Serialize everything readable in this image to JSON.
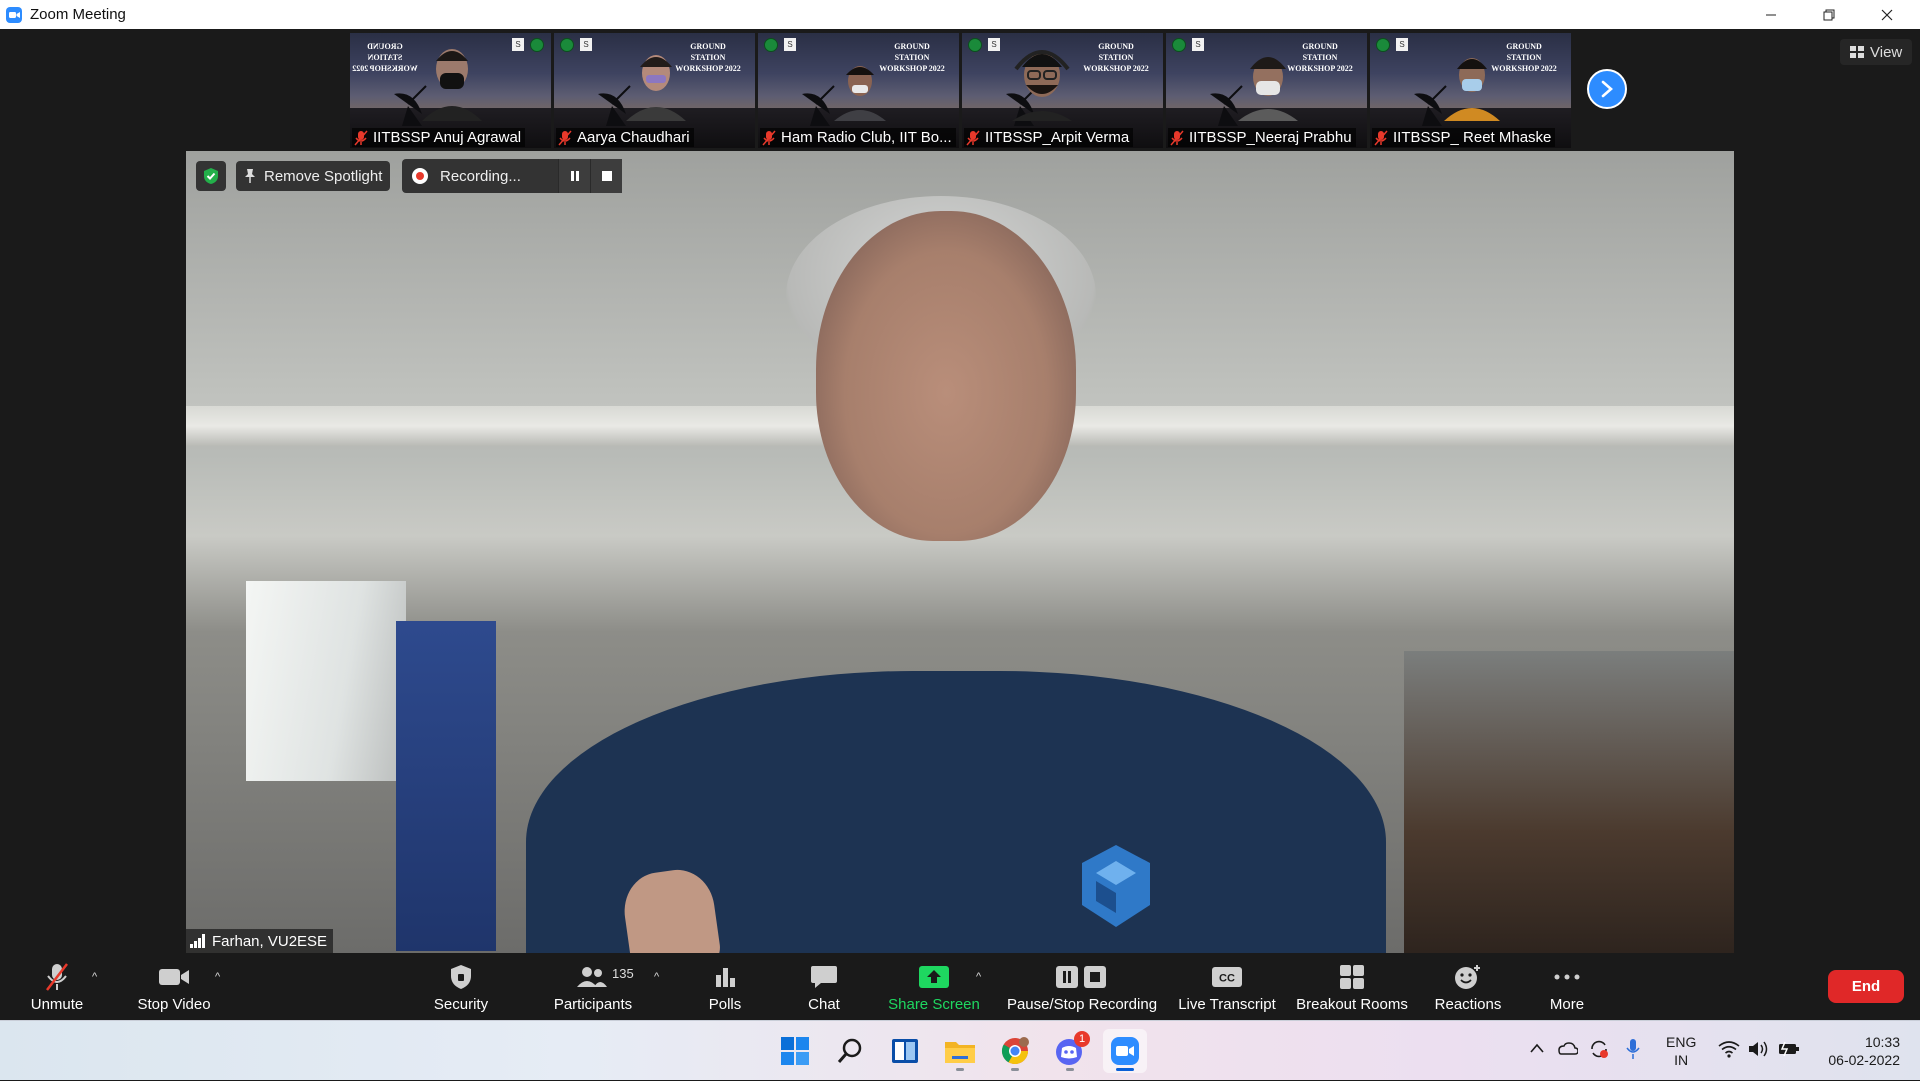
{
  "window": {
    "title": "Zoom Meeting"
  },
  "gallery": {
    "participants": [
      {
        "name": "IITBSSP Anuj Agrawal",
        "banner": "GROUND STATION WORKSHOP 2022",
        "muted": true
      },
      {
        "name": "Aarya Chaudhari",
        "banner": "GROUND STATION WORKSHOP 2022",
        "muted": true
      },
      {
        "name": "Ham Radio Club, IIT Bo...",
        "banner": "GROUND STATION WORKSHOP 2022",
        "muted": true
      },
      {
        "name": "IITBSSP_Arpit Verma",
        "banner": "GROUND STATION WORKSHOP 2022",
        "muted": true
      },
      {
        "name": "IITBSSP_Neeraj Prabhu",
        "banner": "GROUND STATION WORKSHOP 2022",
        "muted": true
      },
      {
        "name": "IITBSSP_ Reet Mhaske",
        "banner": "GROUND STATION WORKSHOP 2022",
        "muted": true
      }
    ],
    "view_label": "View"
  },
  "spotlight": {
    "remove_label": "Remove Spotlight",
    "recording_label": "Recording...",
    "speaker_name": "Farhan, VU2ESE"
  },
  "toolbar": {
    "unmute": "Unmute",
    "stop_video": "Stop Video",
    "security": "Security",
    "participants": "Participants",
    "participants_count": "135",
    "polls": "Polls",
    "chat": "Chat",
    "share_screen": "Share Screen",
    "pause_stop_recording": "Pause/Stop Recording",
    "live_transcript": "Live Transcript",
    "breakout_rooms": "Breakout Rooms",
    "reactions": "Reactions",
    "more": "More",
    "end": "End"
  },
  "taskbar": {
    "apps": [
      "windows-start",
      "search",
      "widgets",
      "file-explorer",
      "chrome",
      "discord",
      "zoom"
    ],
    "discord_badge": "1",
    "lang_top": "ENG",
    "lang_bottom": "IN",
    "time": "10:33",
    "date": "06-02-2022"
  },
  "colors": {
    "zoom_blue": "#2d8cff",
    "end_red": "#e02828",
    "share_green": "#1ed760",
    "mute_red": "#e8392b"
  }
}
